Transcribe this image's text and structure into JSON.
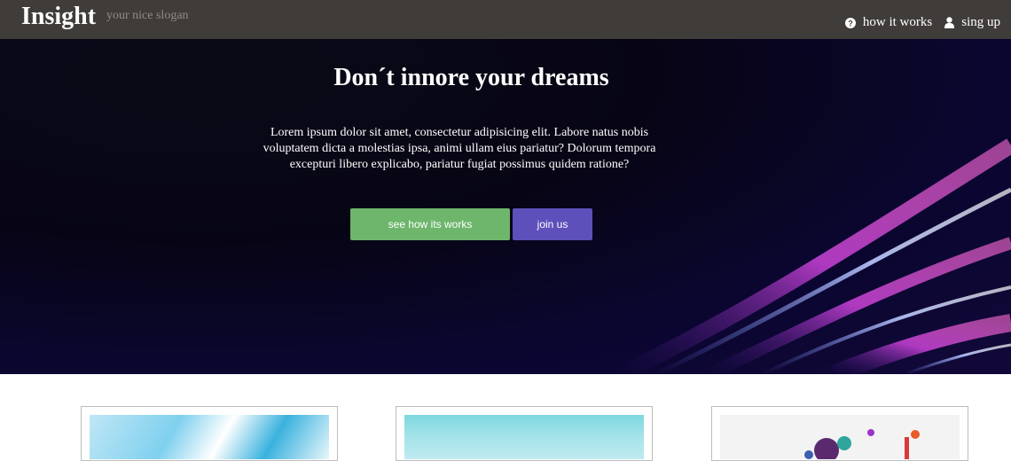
{
  "header": {
    "brand": "Insight",
    "slogan": "your nice slogan",
    "nav": [
      {
        "label": "how it works",
        "icon": "question-circle-icon"
      },
      {
        "label": "sing up",
        "icon": "user-icon"
      }
    ]
  },
  "hero": {
    "title": "Don´t innore your dreams",
    "text": "Lorem ipsum dolor sit amet, consectetur adipisicing elit. Labore natus nobis voluptatem dicta a molestias ipsa, animi ullam eius pariatur? Dolorum tempora excepturi libero explicabo, pariatur fugiat possimus quidem ratione?",
    "primary_button": "see how its works",
    "secondary_button": "join us"
  },
  "colors": {
    "header_bg": "#403c3a",
    "primary_button": "#6db66c",
    "secondary_button": "#5d50bb"
  },
  "cards": [
    {
      "image": "abstract-blue-image"
    },
    {
      "image": "sky-cyan-image"
    },
    {
      "image": "paint-splash-image"
    }
  ]
}
